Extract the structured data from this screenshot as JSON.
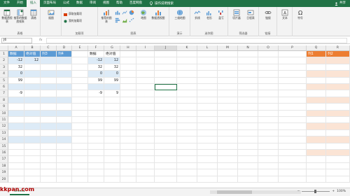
{
  "ribbon_tabs": [
    "文件",
    "开始",
    "插入",
    "页面布局",
    "公式",
    "数据",
    "审阅",
    "视图",
    "帮助",
    "百度网盘"
  ],
  "active_tab_index": 2,
  "tell_me": "操作说明搜索",
  "share_label": "共享",
  "ribbon": {
    "tables_group": {
      "label": "表格",
      "pivot": "数据透视表",
      "recommended_pivot": "推荐的数据透视表",
      "table": "表格"
    },
    "illustrations": {
      "label": "插图"
    },
    "addins_group": {
      "label": "加载项",
      "get_addins": "获取加载项",
      "my_addins": "我的加载项"
    },
    "charts_group": {
      "label": "图表",
      "recommended": "推荐的图表",
      "maps": "地图",
      "pivot_chart": "数据透视图"
    },
    "tours_group": {
      "label": "演示",
      "map3d": "三维地图"
    },
    "sparklines_group": {
      "label": "迷你图",
      "line": "折线",
      "column": "柱形",
      "winloss": "盈亏"
    },
    "filters_group": {
      "label": "筛选器",
      "slicer": "切片器",
      "timeline": "日程表"
    },
    "links_group": {
      "label": "链接",
      "link": "链接"
    },
    "text_group": {
      "label": "",
      "text": "文本"
    },
    "symbols_group": {
      "label": "",
      "symbols": "符号"
    }
  },
  "namebox": "J6",
  "fx_symbol": "fx",
  "columns": [
    "A",
    "B",
    "C",
    "D",
    "E",
    "F",
    "G",
    "H",
    "I",
    "J",
    "K",
    "L",
    "M",
    "N",
    "O",
    "P",
    "Q",
    "R"
  ],
  "selected_column": "J",
  "rows": [
    "1",
    "2",
    "3",
    "4",
    "5",
    "6",
    "7",
    "8",
    "9",
    "10",
    "11",
    "12",
    "13",
    "14",
    "15",
    "16",
    "17",
    "18",
    "19",
    "20"
  ],
  "table1": {
    "headers": [
      "数据",
      "绝对值",
      "列3",
      "列4"
    ],
    "data": [
      [
        "-12",
        "12",
        "",
        ""
      ],
      [
        "32",
        "",
        "",
        ""
      ],
      [
        "0",
        "",
        "",
        ""
      ],
      [
        "99",
        "",
        "",
        ""
      ],
      [
        "",
        "",
        "",
        ""
      ],
      [
        "-9",
        "",
        "",
        ""
      ]
    ]
  },
  "table2": {
    "headers": [
      "数据",
      "绝对值"
    ],
    "data": [
      [
        "-12",
        "12"
      ],
      [
        "32",
        "32"
      ],
      [
        "0",
        "0"
      ],
      [
        "99",
        "99"
      ],
      [
        "",
        ""
      ],
      [
        "-9",
        "9"
      ]
    ]
  },
  "table3": {
    "headers": [
      "列1",
      "列2"
    ]
  },
  "sheet_tab": "Sheet1",
  "zoom_level": "100%",
  "watermark": "kkpan.com",
  "colors": {
    "excel_green": "#217346",
    "table_blue_header": "#5b9bd5",
    "table_blue_band": "#ddebf7",
    "table_orange_header": "#ed7d31",
    "table_orange_band": "#fbe4d5"
  }
}
